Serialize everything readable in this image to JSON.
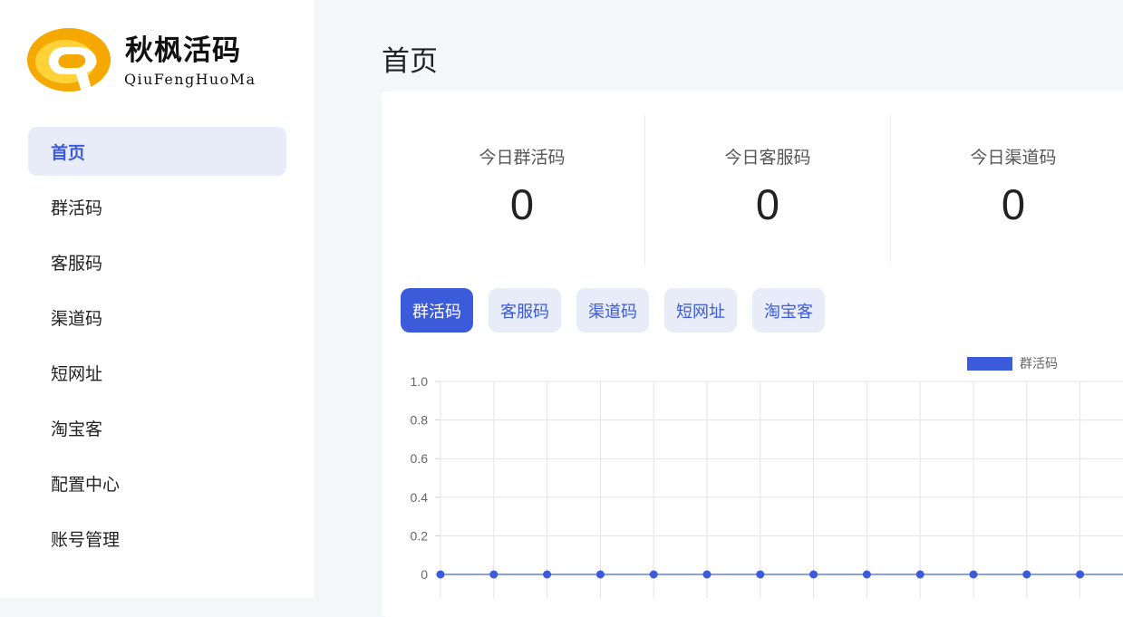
{
  "brand": {
    "name_cn": "秋枫活码",
    "name_en": "QiuFengHuoMa",
    "logo_icon": "qf-logo-icon",
    "colors": {
      "logo_orange": "#f5a800",
      "logo_yellow": "#ffd23a"
    }
  },
  "sidebar": {
    "items": [
      {
        "label": "首页",
        "active": true
      },
      {
        "label": "群活码"
      },
      {
        "label": "客服码"
      },
      {
        "label": "渠道码"
      },
      {
        "label": "短网址"
      },
      {
        "label": "淘宝客"
      },
      {
        "label": "配置中心"
      },
      {
        "label": "账号管理"
      }
    ]
  },
  "page": {
    "title": "首页"
  },
  "stats": [
    {
      "label": "今日群活码",
      "value": "0"
    },
    {
      "label": "今日客服码",
      "value": "0"
    },
    {
      "label": "今日渠道码",
      "value": "0"
    }
  ],
  "tabs": [
    {
      "label": "群活码",
      "active": true
    },
    {
      "label": "客服码"
    },
    {
      "label": "渠道码"
    },
    {
      "label": "短网址"
    },
    {
      "label": "淘宝客"
    }
  ],
  "colors": {
    "accent": "#3b5bdb",
    "accent_light": "#e8ebf8"
  },
  "chart_data": {
    "type": "line",
    "series": [
      {
        "name": "群活码",
        "values": [
          0,
          0,
          0,
          0,
          0,
          0,
          0,
          0,
          0,
          0,
          0,
          0,
          0
        ]
      }
    ],
    "ylim": [
      0,
      1.0
    ],
    "yticks": [
      "0",
      "0.2",
      "0.4",
      "0.6",
      "0.8",
      "1.0"
    ],
    "grid": true,
    "legend": "top-right",
    "color": "#3b5bdb"
  }
}
